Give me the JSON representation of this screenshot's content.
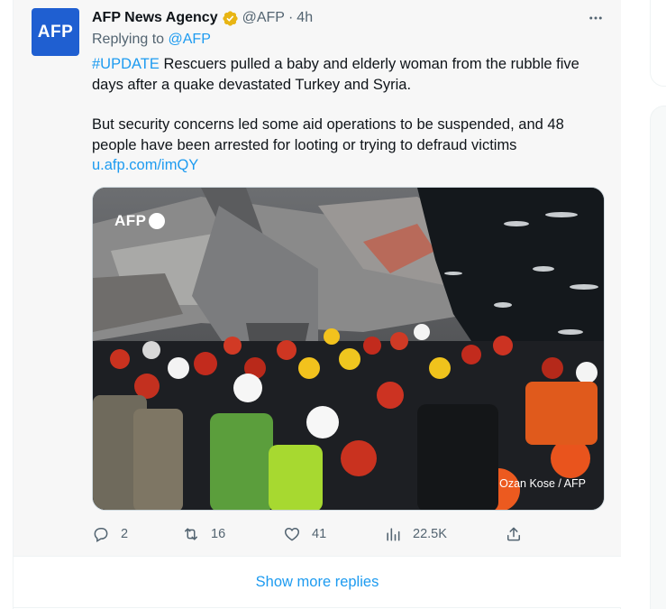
{
  "tweet": {
    "avatar_text": "AFP",
    "display_name": "AFP News Agency",
    "verified_badge_color": "#e8b514",
    "handle": "@AFP",
    "separator": "·",
    "time": "4h",
    "more_icon": "more-horizontal-icon",
    "replying_label": "Replying to",
    "replying_mention": "@AFP",
    "hashtag": "#UPDATE",
    "text_line1": " Rescuers pulled a baby and elderly woman from the rubble five days after a quake devastated Turkey and Syria.",
    "text_line2": "But security concerns led some aid operations to be suspended, and 48 people have been arrested for looting or trying to defraud victims",
    "link": "u.afp.com/imQY",
    "media": {
      "watermark": "AFP",
      "credit": "Ozan Kose / AFP"
    },
    "actions": {
      "reply_count": "2",
      "retweet_count": "16",
      "like_count": "41",
      "views_count": "22.5K"
    }
  },
  "show_more_replies": "Show more replies",
  "colors": {
    "link": "#1d9bf0",
    "secondary_text": "#536471",
    "avatar_bg": "#1f5fd1"
  }
}
